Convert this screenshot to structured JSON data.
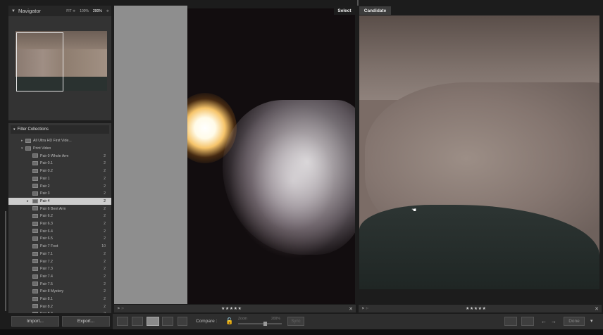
{
  "navigator": {
    "title": "Navigator",
    "zoom_options": [
      "FIT ≑",
      "100%",
      "200%",
      "≑"
    ],
    "active_zoom": "200%"
  },
  "filter_collections": {
    "title": "Filter Collections",
    "rows": [
      {
        "label": "All Ultra HD First Vide...",
        "count": "",
        "level": 1,
        "expander": "▸"
      },
      {
        "label": "Print Video",
        "count": "",
        "level": 1,
        "expander": "▾"
      },
      {
        "label": "Pair 0 Whole Arm",
        "count": "2",
        "level": 2
      },
      {
        "label": "Pair 0.1",
        "count": "2",
        "level": 2
      },
      {
        "label": "Pair 0.2",
        "count": "2",
        "level": 2
      },
      {
        "label": "Pair 1",
        "count": "2",
        "level": 2
      },
      {
        "label": "Pair 2",
        "count": "2",
        "level": 2
      },
      {
        "label": "Pair 3",
        "count": "2",
        "level": 2
      },
      {
        "label": "Pair 4",
        "count": "2",
        "level": 2,
        "selected": true
      },
      {
        "label": "Pair 6 Bent Arm",
        "count": "2",
        "level": 2
      },
      {
        "label": "Pair 6.2",
        "count": "2",
        "level": 2
      },
      {
        "label": "Pair 6.3",
        "count": "2",
        "level": 2
      },
      {
        "label": "Pair 6.4",
        "count": "2",
        "level": 2
      },
      {
        "label": "Pair 6.5",
        "count": "2",
        "level": 2
      },
      {
        "label": "Pair 7 Foot",
        "count": "10",
        "level": 2
      },
      {
        "label": "Pair 7.1",
        "count": "2",
        "level": 2
      },
      {
        "label": "Pair 7.2",
        "count": "2",
        "level": 2
      },
      {
        "label": "Pair 7.3",
        "count": "2",
        "level": 2
      },
      {
        "label": "Pair 7.4",
        "count": "2",
        "level": 2
      },
      {
        "label": "Pair 7.5",
        "count": "2",
        "level": 2
      },
      {
        "label": "Pair 8 Mystery",
        "count": "2",
        "level": 2
      },
      {
        "label": "Pair 8.1",
        "count": "2",
        "level": 2
      },
      {
        "label": "Pair 8.2",
        "count": "2",
        "level": 2
      },
      {
        "label": "Pair 8.3",
        "count": "2",
        "level": 2
      }
    ]
  },
  "left_buttons": {
    "import": "Import...",
    "export": "Export..."
  },
  "compare": {
    "select_label": "Select",
    "candidate_label": "Candidate",
    "select_rating": "★★★★★",
    "candidate_rating": "★★★★★",
    "close": "✕"
  },
  "toolbar": {
    "compare_label": "Compare :",
    "zoom_label": "Zoom",
    "zoom_value": "200%",
    "sync_label": "Sync",
    "done_label": "Done",
    "prev": "←",
    "next": "→",
    "menu": "▾"
  },
  "colors": {
    "selected_row": "#cdcdcd",
    "panel": "#2d2d2d",
    "background": "#1c1c1c"
  }
}
